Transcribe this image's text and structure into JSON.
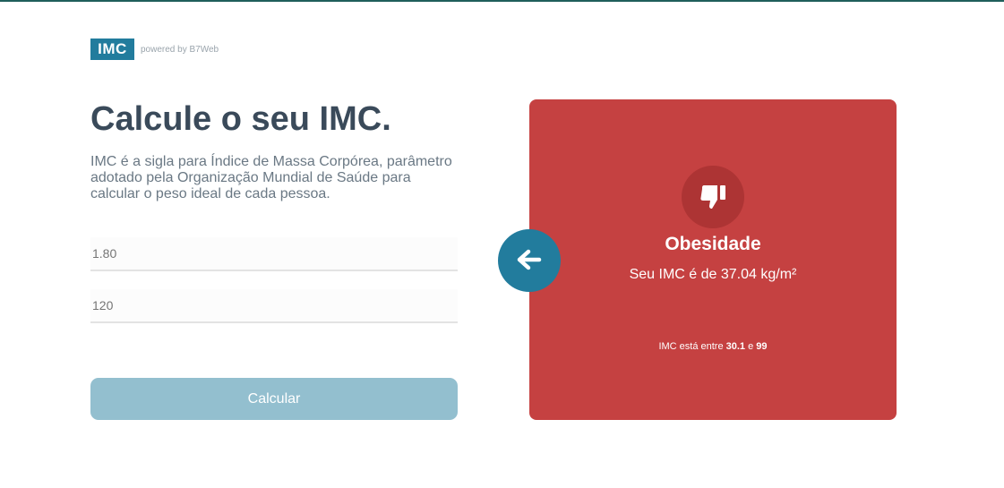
{
  "header": {
    "logo_text": "IMC",
    "powered_by": "powered by B7Web"
  },
  "main": {
    "title": "Calcule o seu IMC.",
    "description": "IMC é a sigla para Índice de Massa Corpórea, parâmetro adotado pela Organização Mundial de Saúde para calcular o peso ideal de cada pessoa.",
    "height_input": {
      "value": "",
      "placeholder": "1.80"
    },
    "weight_input": {
      "value": "",
      "placeholder": "120"
    },
    "calculate_label": "Calcular"
  },
  "result": {
    "icon": "thumbs-down-icon",
    "title": "Obesidade",
    "value_text": "Seu IMC é de 37.04 kg/m²",
    "range_prefix": "IMC está entre ",
    "range_min": "30.1",
    "range_joiner": " e ",
    "range_max": "99",
    "color": "#c54141"
  },
  "back_button": {
    "icon": "arrow-left-icon",
    "color": "#227c9d"
  }
}
